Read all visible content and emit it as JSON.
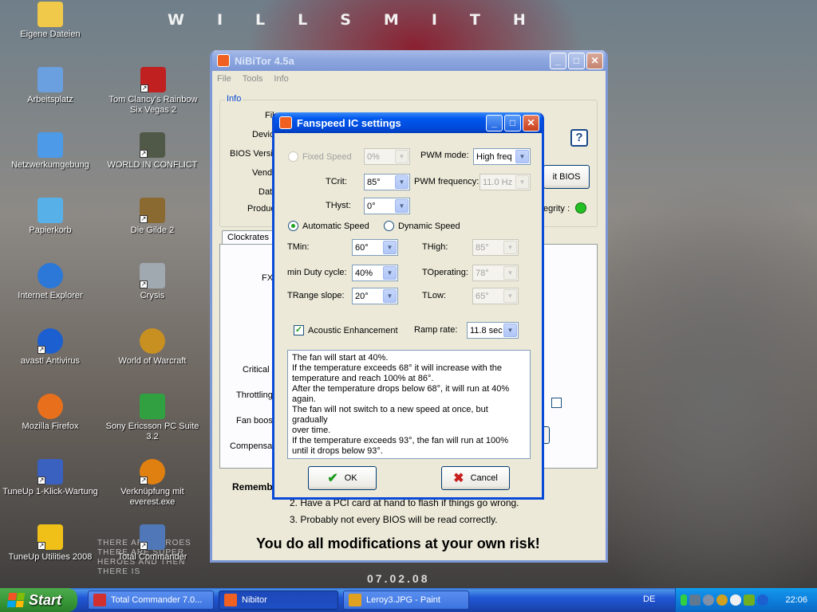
{
  "wallpaper": {
    "title": "WILLSMITH",
    "tagline": "THERE ARE HEROES THERE ARE SUPER HEROES AND THEN THERE IS",
    "date": "07.02.08"
  },
  "desktop_icons": [
    {
      "label": "Eigene Dateien",
      "icon": "folder-icon",
      "color": "#f0c84a"
    },
    {
      "label": "Arbeitsplatz",
      "icon": "computer-icon",
      "color": "#6aa0e0"
    },
    {
      "label": "Netzwerkumgebung",
      "icon": "network-icon",
      "color": "#4c9ae8"
    },
    {
      "label": "Papierkorb",
      "icon": "recycle-bin-icon",
      "color": "#58b0e8"
    },
    {
      "label": "Internet Explorer",
      "icon": "internet-explorer-icon",
      "color": "#2c78d8"
    },
    {
      "label": "avast! Antivirus",
      "icon": "avast-icon",
      "color": "#1c5fd0"
    },
    {
      "label": "Mozilla Firefox",
      "icon": "firefox-icon",
      "color": "#e8701c"
    },
    {
      "label": "TuneUp 1-Klick-Wartung",
      "icon": "tuneup-icon",
      "color": "#3a60c0"
    },
    {
      "label": "TuneUp Utilities 2008",
      "icon": "tuneup-utilities-icon",
      "color": "#f0c018"
    },
    {
      "label": "Tom Clancy's Rainbow Six Vegas 2",
      "icon": "rainbow-six-icon",
      "color": "#c02020"
    },
    {
      "label": "WORLD IN CONFLICT",
      "icon": "world-in-conflict-icon",
      "color": "#505848"
    },
    {
      "label": "Die Gilde 2",
      "icon": "die-gilde-icon",
      "color": "#8a6a30"
    },
    {
      "label": "Crysis",
      "icon": "crysis-icon",
      "color": "#a0a8b0"
    },
    {
      "label": "World of Warcraft",
      "icon": "world-of-warcraft-icon",
      "color": "#c89020"
    },
    {
      "label": "Sony Ericsson PC Suite 3.2",
      "icon": "sony-ericsson-icon",
      "color": "#30a040"
    },
    {
      "label": "Verknüpfung mit everest.exe",
      "icon": "everest-icon",
      "color": "#e08010"
    },
    {
      "label": "Total Commander",
      "icon": "total-commander-icon",
      "color": "#5078b8"
    }
  ],
  "nibitor": {
    "title": "NiBiTor 4.5a",
    "menu": [
      "File",
      "Tools",
      "Info"
    ],
    "info_group": "Info",
    "info_labels": [
      "Fil",
      "Devic",
      "BIOS Versio",
      "Vendo",
      "Dat",
      "Produc"
    ],
    "edit_bios_button": "it BIOS",
    "integrity_label": "egrity :",
    "integrity_color": "#22c022",
    "help_icon": "?",
    "tab": "Clockrates",
    "panel_labels": [
      "FX",
      "Critical",
      "Throttling",
      "Fan boost",
      "Compensati"
    ],
    "remember_label": "Rememb",
    "notes": [
      "2. Have a PCI card at hand to flash if things go wrong.",
      "3. Probably not every BIOS will be read correctly."
    ],
    "warning": "You do all modifications at your own risk!"
  },
  "fanspeed": {
    "title": "Fanspeed IC settings",
    "fixed_speed_label": "Fixed Speed",
    "fixed_speed_value": "0%",
    "pwm_mode_label": "PWM mode:",
    "pwm_mode_value": "High freq",
    "tcrit_label": "TCrit:",
    "tcrit_value": "85°",
    "pwm_freq_label": "PWM frequency:",
    "pwm_freq_value": "11.0 Hz",
    "thyst_label": "THyst:",
    "thyst_value": "0°",
    "automatic_speed_label": "Automatic Speed",
    "dynamic_speed_label": "Dynamic Speed",
    "tmin_label": "TMin:",
    "tmin_value": "60°",
    "thigh_label": "THigh:",
    "thigh_value": "85°",
    "min_duty_label": "min Duty cycle:",
    "min_duty_value": "40%",
    "toperating_label": "TOperating:",
    "toperating_value": "78°",
    "trange_label": "TRange slope:",
    "trange_value": "20°",
    "tlow_label": "TLow:",
    "tlow_value": "65°",
    "acoustic_label": "Acoustic Enhancement",
    "acoustic_checked": true,
    "ramp_rate_label": "Ramp rate:",
    "ramp_rate_value": "11.8 sec",
    "description": [
      "The fan will start at 40%.",
      "If the temperature exceeds 68° it will increase with the",
      "temperature and reach 100% at 86°.",
      "After the temperature drops below 68°, it will run at 40%",
      "again.",
      "The fan will not switch to a new speed at once, but gradually",
      "over time.",
      "If the temperature exceeds 93°, the fan will run at 100%",
      "until it drops below 93°."
    ],
    "ok_label": "OK",
    "cancel_label": "Cancel"
  },
  "taskbar": {
    "start_label": "Start",
    "items": [
      {
        "label": "Total Commander 7.0...",
        "icon_color": "#d03030"
      },
      {
        "label": "Nibitor",
        "icon_color": "#f06020"
      },
      {
        "label": "Leroy3.JPG - Paint",
        "icon_color": "#e0a020"
      }
    ],
    "language": "DE",
    "clock": "22:06"
  }
}
